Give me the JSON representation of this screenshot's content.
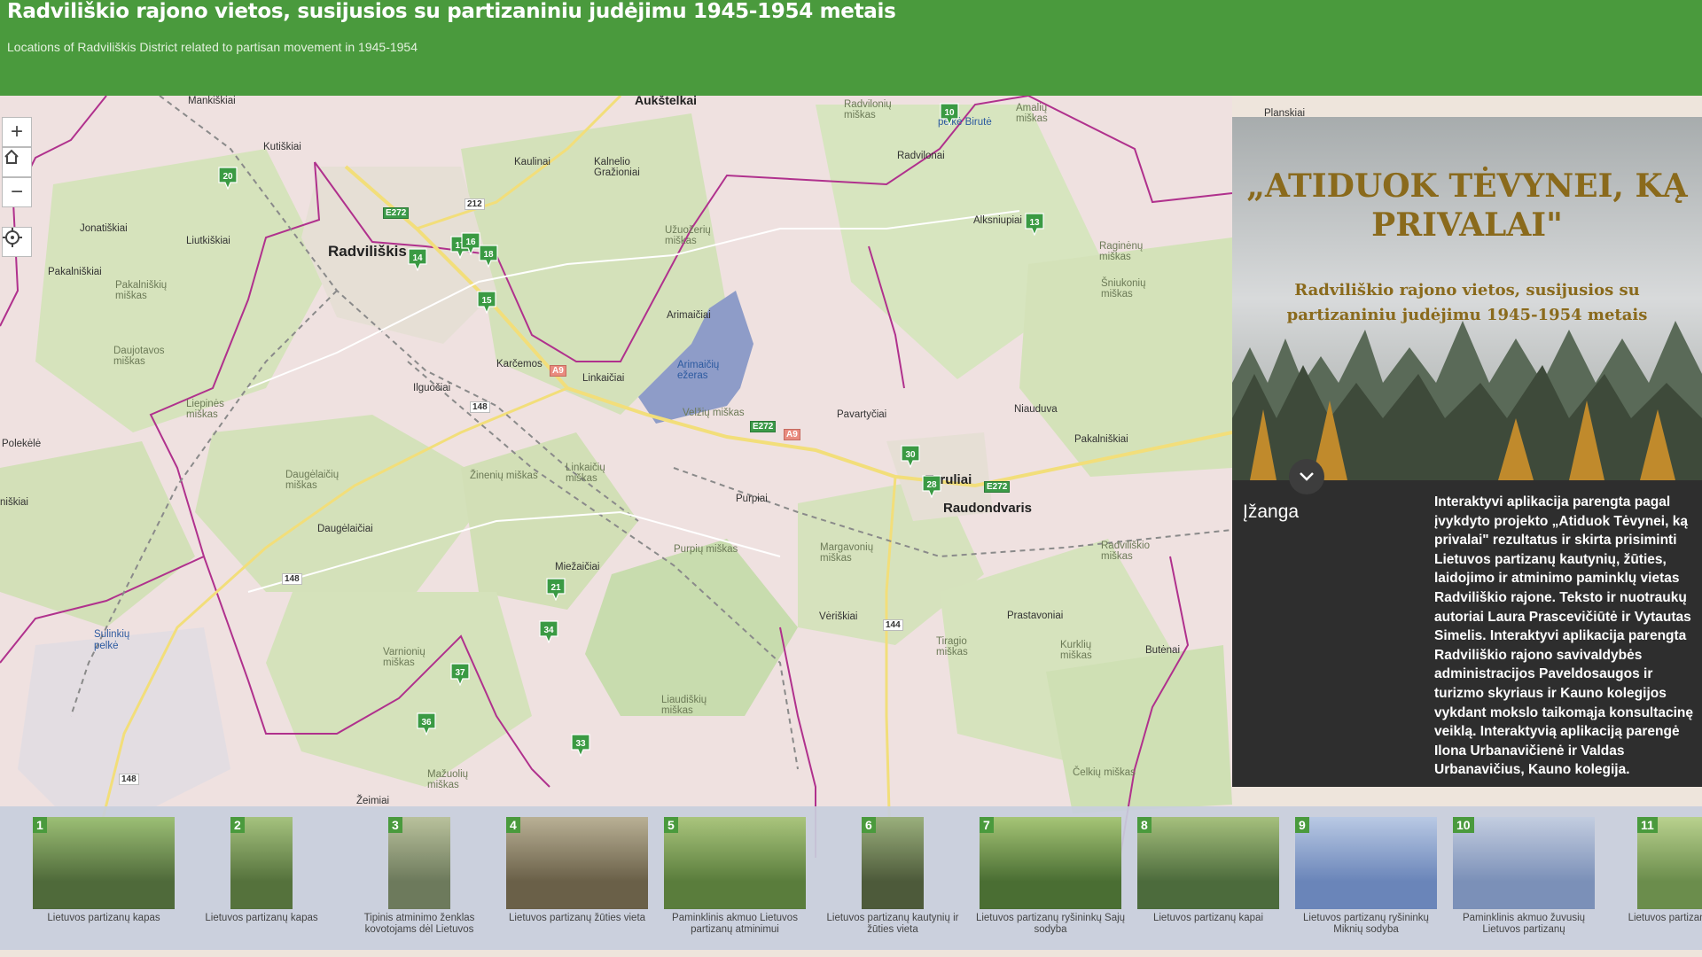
{
  "header": {
    "title": "Radviliškio rajono vietos, susijusios su partizaniniu judėjimu 1945-1954 metais",
    "subtitle": "Locations of Radviliškis District related to partisan movement in 1945-1954"
  },
  "map": {
    "place_labels": [
      {
        "id": "manksiai",
        "text": "Mankiškiai"
      },
      {
        "id": "aukstelkai",
        "text": "Aukštelkai"
      },
      {
        "id": "radvilonys-miskas",
        "text": "Radvilonių miškas"
      },
      {
        "id": "amaliu-miskas",
        "text": "Amalių miškas"
      },
      {
        "id": "pelke-birute",
        "text": "pelkė Birutė"
      },
      {
        "id": "kutiskiai",
        "text": "Kutiškiai"
      },
      {
        "id": "kaulinai",
        "text": "Kaulinai"
      },
      {
        "id": "kalnelio",
        "text": "Kalnelio Gražioniai"
      },
      {
        "id": "radvilonai",
        "text": "Radvilonai"
      },
      {
        "id": "radviliskis",
        "text": "Radviliškis"
      },
      {
        "id": "jonatiskiai",
        "text": "Jonatiškiai"
      },
      {
        "id": "liutkiskiai",
        "text": "Liutkiškiai"
      },
      {
        "id": "uzuozeriu",
        "text": "Užuožerių miškas"
      },
      {
        "id": "alksniupiai",
        "text": "Alksniupiai"
      },
      {
        "id": "raginenu",
        "text": "Raginėnų miškas"
      },
      {
        "id": "pakalniskiai",
        "text": "Pakalniškiai"
      },
      {
        "id": "pakalniskiu-miskas",
        "text": "Pakalniškių miškas"
      },
      {
        "id": "sniukoniu",
        "text": "Šniukonių miškas"
      },
      {
        "id": "arimaiciai",
        "text": "Arimaičiai"
      },
      {
        "id": "daujotavos",
        "text": "Daujotavos miškas"
      },
      {
        "id": "karcemos",
        "text": "Karčemos"
      },
      {
        "id": "linkaiciai",
        "text": "Linkaičiai"
      },
      {
        "id": "arimaiciu-ezeras",
        "text": "Arimaičių ežeras"
      },
      {
        "id": "ilguciai",
        "text": "Ilguočiai"
      },
      {
        "id": "velziu",
        "text": "Velžių miškas"
      },
      {
        "id": "pavartyciai",
        "text": "Pavartyčiai"
      },
      {
        "id": "niauduva",
        "text": "Niauduva"
      },
      {
        "id": "liepines",
        "text": "Liepinės miškas"
      },
      {
        "id": "polekele",
        "text": "Polekėlė"
      },
      {
        "id": "pakalniskiai2",
        "text": "Pakalniškiai"
      },
      {
        "id": "daugelaiciu",
        "text": "Daugėlaičių miškas"
      },
      {
        "id": "zineniu",
        "text": "Žinenių miškas"
      },
      {
        "id": "linkaiciu-miskas",
        "text": "Linkaičių miškas"
      },
      {
        "id": "purpiai",
        "text": "Purpiai"
      },
      {
        "id": "tyruliai",
        "text": "Tyruliai"
      },
      {
        "id": "raudondvaris",
        "text": "Raudondvaris"
      },
      {
        "id": "daugelaiciai",
        "text": "Daugėlaičiai"
      },
      {
        "id": "purpiu",
        "text": "Purpių miškas"
      },
      {
        "id": "margavoniu",
        "text": "Margavonių miškas"
      },
      {
        "id": "miezaiciai",
        "text": "Miežaičiai"
      },
      {
        "id": "radviliskio-miskas",
        "text": "Radviliškio miškas"
      },
      {
        "id": "sulinkiu",
        "text": "Sulinkių pelkė"
      },
      {
        "id": "veriskiai",
        "text": "Vėriškiai"
      },
      {
        "id": "prastavoniai",
        "text": "Prastavoniai"
      },
      {
        "id": "varnioniu",
        "text": "Varnionių miškas"
      },
      {
        "id": "tiragio",
        "text": "Tiragio miškas"
      },
      {
        "id": "kurkliu",
        "text": "Kurklių miškas"
      },
      {
        "id": "butenai",
        "text": "Butėnai"
      },
      {
        "id": "liaudiskiu",
        "text": "Liaudiškių miškas"
      },
      {
        "id": "mazuoliu",
        "text": "Mažuolių miškas"
      },
      {
        "id": "celkiu",
        "text": "Čelkių miškas"
      },
      {
        "id": "zeimiai",
        "text": "Žeimiai"
      },
      {
        "id": "planskiai",
        "text": "Planskiai"
      },
      {
        "id": "nisklaukiai",
        "text": "niškiai"
      }
    ],
    "road_labels": [
      {
        "id": "e272a",
        "text": "E272",
        "kind": "green"
      },
      {
        "id": "r212",
        "text": "212",
        "kind": "white"
      },
      {
        "id": "a9a",
        "text": "A9",
        "kind": "red"
      },
      {
        "id": "r148a",
        "text": "148",
        "kind": "white"
      },
      {
        "id": "e272b",
        "text": "E272",
        "kind": "green"
      },
      {
        "id": "a9b",
        "text": "A9",
        "kind": "red"
      },
      {
        "id": "e272c",
        "text": "E272",
        "kind": "green"
      },
      {
        "id": "r148b",
        "text": "148",
        "kind": "white"
      },
      {
        "id": "r144",
        "text": "144",
        "kind": "white"
      },
      {
        "id": "r148c",
        "text": "148",
        "kind": "white"
      }
    ],
    "markers": [
      "20",
      "14",
      "17",
      "16",
      "18",
      "15",
      "10",
      "13",
      "30",
      "28",
      "21",
      "34",
      "37",
      "36",
      "33"
    ]
  },
  "controls": {
    "zoom_in": "+",
    "zoom_out": "−"
  },
  "info_panel": {
    "title": "„ATIDUOK TĖVYNEI, KĄ PRIVALAI\"",
    "subtitle": "Radviliškio rajono vietos, susijusios su partizaniniu judėjimu 1945-1954 metais",
    "section_title": "Įžanga",
    "body": "Interaktyvi aplikacija parengta pagal įvykdyto projekto „Atiduok Tėvynei, ką privalai\" rezultatus ir skirta prisiminti Lietuvos partizanų kautynių, žūties, laidojimo ir atminimo paminklų vietas Radviliškio rajone. Teksto ir nuotraukų autoriai Laura Prascevičiūtė ir Vytautas Simelis. Interaktyvi aplikacija parengta Radviliškio rajono savivaldybės administracijos Paveldosaugos ir turizmo skyriaus ir Kauno kolegijos vykdant mokslo taikomąja konsultacinę veiklą. Interaktyvią aplikaciją parengė Ilona Urbanavičienė ir Valdas Urbanavičius, Kauno kolegija."
  },
  "carousel": [
    {
      "num": "1",
      "caption": "Lietuvos partizanų kapas"
    },
    {
      "num": "2",
      "caption": "Lietuvos partizanų kapas"
    },
    {
      "num": "3",
      "caption": "Tipinis atminimo ženklas kovotojams dėl Lietuvos"
    },
    {
      "num": "4",
      "caption": "Lietuvos partizanų žūties vieta"
    },
    {
      "num": "5",
      "caption": "Paminklinis akmuo Lietuvos partizanų atminimui"
    },
    {
      "num": "6",
      "caption": "Lietuvos partizanų kautynių ir žūties vieta"
    },
    {
      "num": "7",
      "caption": "Lietuvos partizanų ryšininkų Sajų sodyba"
    },
    {
      "num": "8",
      "caption": "Lietuvos partizanų kapai"
    },
    {
      "num": "9",
      "caption": "Lietuvos partizanų ryšininkų Miknių sodyba"
    },
    {
      "num": "10",
      "caption": "Paminklinis akmuo žuvusių Lietuvos partizanų"
    },
    {
      "num": "11",
      "caption": "Lietuvos partizanų vieta"
    }
  ],
  "colors": {
    "header": "#4a9a3d",
    "forest": "#c9dcab",
    "boundary": "#b0318d",
    "title_gold": "#8a6a1c"
  }
}
